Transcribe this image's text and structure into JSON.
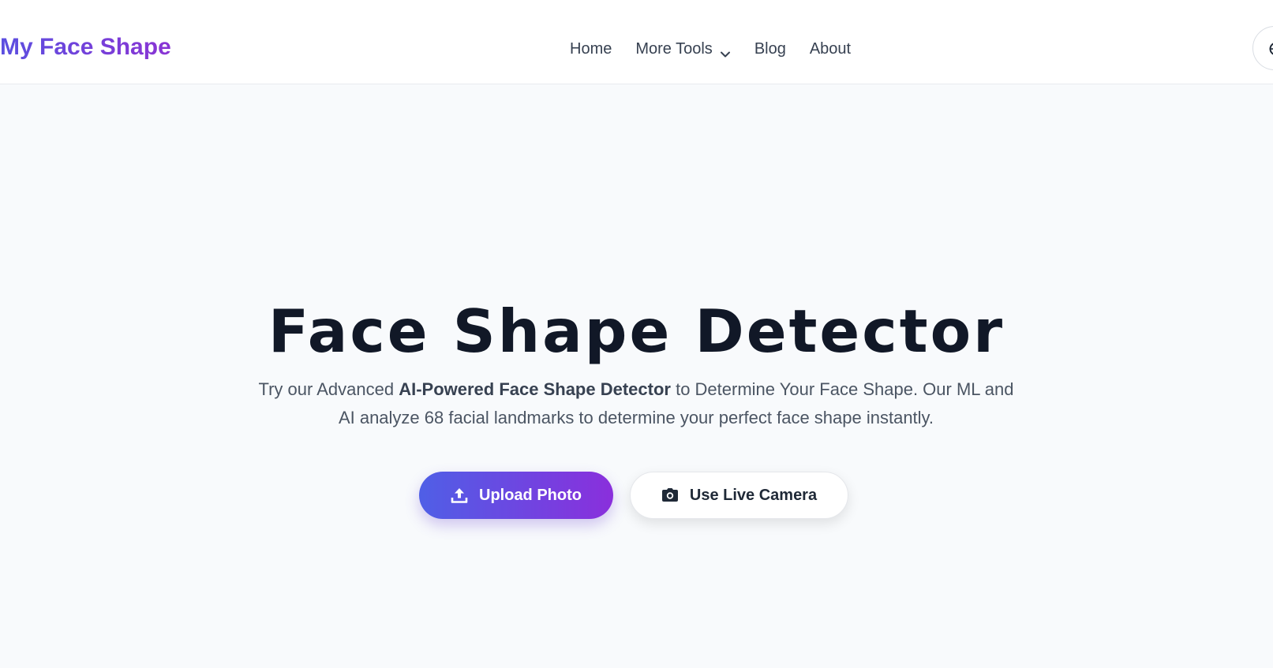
{
  "header": {
    "logo": "My Face Shape",
    "nav": [
      {
        "label": "Home"
      },
      {
        "label": "More Tools",
        "has_dropdown": true
      },
      {
        "label": "Blog"
      },
      {
        "label": "About"
      }
    ],
    "language_icon": "globe-icon"
  },
  "hero": {
    "title": "Face Shape Detector",
    "subtitle_part1": "Try our Advanced ",
    "subtitle_bold": "AI-Powered Face Shape Detector",
    "subtitle_part2": " to Determine Your Face Shape. Our ML and AI analyze 68 facial landmarks to determine your perfect face shape instantly.",
    "upload_button": "Upload Photo",
    "camera_button": "Use Live Camera"
  },
  "colors": {
    "brand_gradient_start": "#4f5fe6",
    "brand_gradient_end": "#8a2fdc",
    "title_text": "#111827",
    "page_background": "#f8fafc"
  }
}
